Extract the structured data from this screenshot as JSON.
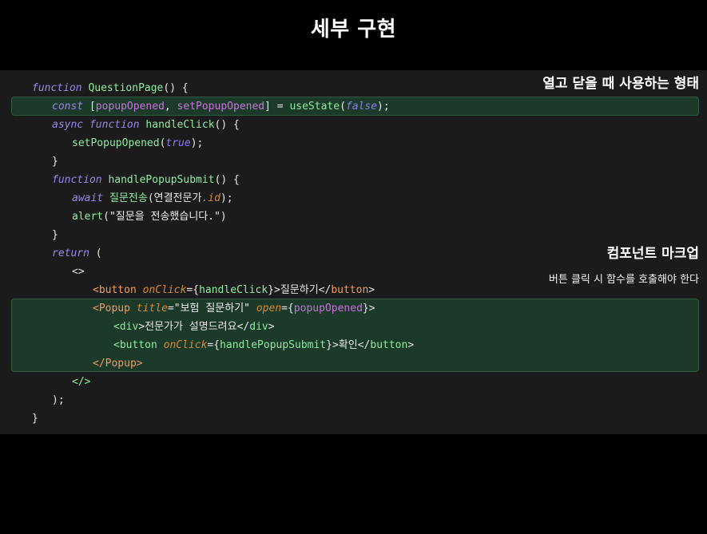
{
  "title": "세부 구현",
  "annotations": {
    "top": "열고 닫을 때 사용하는 형태",
    "markup_title": "컴포넌트 마크업",
    "markup_desc": "버튼 클릭 시 함수를 호출해야 한다"
  },
  "code": {
    "l1": {
      "kw": "function",
      "name": "QuestionPage",
      "rest": "() {"
    },
    "l2": {
      "kw": "const",
      "open": " [",
      "v1": "popupOpened",
      "comma": ", ",
      "v2": "setPopupOpened",
      "mid": "] = ",
      "fn": "useState",
      "p1": "(",
      "bool": "false",
      "p2": ");"
    },
    "l3": {
      "kw1": "async",
      "kw2": "function",
      "name": "handleClick",
      "rest": "() {"
    },
    "l4": {
      "fn": "setPopupOpened",
      "p1": "(",
      "bool": "true",
      "p2": ");"
    },
    "l5": {
      "text": "}"
    },
    "l6": {
      "kw": "function",
      "name": "handlePopupSubmit",
      "rest": "() {"
    },
    "l7": {
      "kw": "await",
      "fn": "질문전송",
      "p1": "(연결전문가",
      "prop": ".id",
      "p2": ");"
    },
    "l8": {
      "fn": "alert",
      "p1": "(",
      "str": "\"질문을 전송했습니다.\"",
      "p2": ")"
    },
    "l9": {
      "text": "}"
    },
    "l10": {
      "kw": "return",
      "rest": " ("
    },
    "l11": {
      "text": "<>"
    },
    "l12": {
      "open": "<",
      "tag": "button",
      "attr": "onClick",
      "eq": "={",
      "val": "handleClick",
      "close": "}>질문하기</",
      "tag2": "button",
      "end": ">"
    },
    "l13": {
      "open": "<",
      "tag": "Popup",
      "attr1": "title",
      "eq1": "=",
      "str": "\"보험 질문하기\"",
      "attr2": "open",
      "eq2": "={",
      "val": "popupOpened",
      "end": "}>"
    },
    "l14": {
      "open": "<",
      "tag": "div",
      "text": ">전문가가 설명드려요</",
      "tag2": "div",
      "end": ">"
    },
    "l15": {
      "open": "<",
      "tag": "button",
      "attr": "onClick",
      "eq": "={",
      "val": "handlePopupSubmit",
      "close": "}>확인</",
      "tag2": "button",
      "end": ">"
    },
    "l16": {
      "open": "</",
      "tag": "Popup",
      "end": ">"
    },
    "l17": {
      "text": "</>"
    },
    "l18": {
      "text": ");"
    },
    "l19": {
      "text": "}"
    }
  },
  "colors": {
    "background": "#000000",
    "panel": "#1b1b1b",
    "highlight": "#1c3a2a",
    "keyword": "#9b86e8",
    "function": "#8fe8a0",
    "variable": "#c873d9",
    "tag": "#f29a5f",
    "attribute": "#d28a3a"
  }
}
